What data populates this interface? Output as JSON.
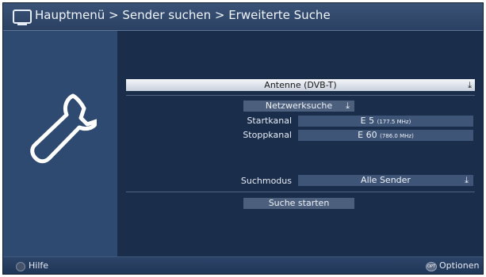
{
  "header": {
    "icon": "tv-icon",
    "breadcrumb": "Hauptmenü > Sender suchen > Erweiterte Suche"
  },
  "sidebar": {
    "icon": "wrench-icon"
  },
  "form": {
    "source": "Antenne (DVB-T)",
    "network_search": "Netzwerksuche",
    "start_channel": {
      "label": "Startkanal",
      "value": "E 5",
      "freq": "(177.5 MHz)"
    },
    "stop_channel": {
      "label": "Stoppkanal",
      "value": "E 60",
      "freq": "(786.0 MHz)"
    },
    "search_mode": {
      "label": "Suchmodus",
      "value": "Alle Sender"
    },
    "start_button": "Suche starten",
    "dropdown_icon": "download-arrow-icon"
  },
  "footer": {
    "help": "Hilfe",
    "opt_key": "OPT",
    "options": "Optionen"
  },
  "colors": {
    "background": "#1a2d4b",
    "sidebar": "#2f4a70",
    "header": "#2a4163",
    "field": "#3f5577"
  }
}
